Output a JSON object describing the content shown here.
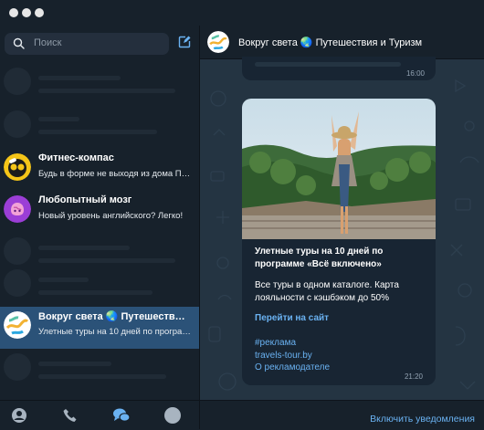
{
  "sidebar": {
    "search_placeholder": "Поиск",
    "chats": [
      {
        "name": "Фитнес-компас",
        "preview": "Будь в форме не выходя из дома  По..."
      },
      {
        "name": "Любопытный мозг",
        "preview": "Новый уровень английского? Легко!"
      },
      {
        "name": "Вокруг света 🌏 Путешествия и...",
        "preview": "Улетные туры на 10 дней по програм..."
      }
    ],
    "tabs": [
      "contacts-icon",
      "calls-icon",
      "chats-icon",
      "settings-icon"
    ]
  },
  "channel": {
    "title": "Вокруг света 🌏 Путешествия и Туризм",
    "prev_time": "16:00",
    "ad": {
      "title": "Улетные туры на 10 дней по программе «Всё включено»",
      "body": "Все туры в одном каталоге. Карта лояльности с кэшбэком до 50%",
      "link": "Перейти на сайт",
      "tag1": "#реклама",
      "tag2": "travels-tour.by",
      "tag3": "О рекламодателе",
      "time": "21:20"
    },
    "footer_button": "Включить уведомления"
  },
  "colors": {
    "accent": "#6ab2f2",
    "active_row": "#2b5278",
    "background": "#17212b"
  }
}
